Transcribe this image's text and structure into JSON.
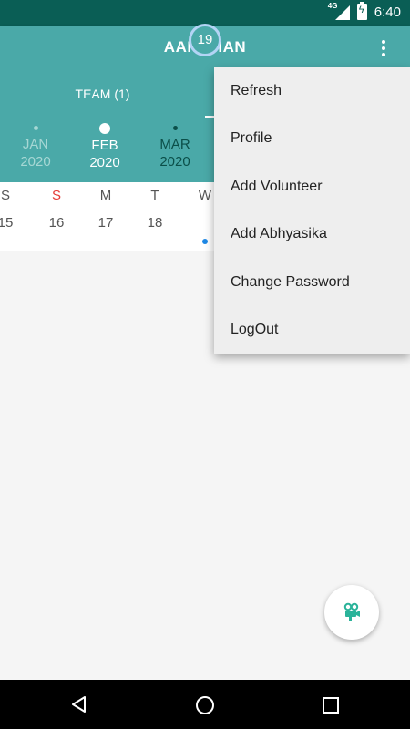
{
  "status": {
    "network": "4G",
    "time": "6:40"
  },
  "app": {
    "title": "AAROHAN"
  },
  "tabs": [
    {
      "label": "TEAM (1)"
    }
  ],
  "months": [
    {
      "name": "JAN",
      "year": "2020"
    },
    {
      "name": "FEB",
      "year": "2020"
    },
    {
      "name": "MAR",
      "year": "2020"
    }
  ],
  "week": [
    {
      "weekday": "S",
      "date": "15"
    },
    {
      "weekday": "S",
      "date": "16"
    },
    {
      "weekday": "M",
      "date": "17"
    },
    {
      "weekday": "T",
      "date": "18"
    },
    {
      "weekday": "W",
      "date": "19"
    }
  ],
  "menu": [
    {
      "label": "Refresh"
    },
    {
      "label": "Profile"
    },
    {
      "label": "Add Volunteer"
    },
    {
      "label": "Add Abhyasika"
    },
    {
      "label": "Change Password"
    },
    {
      "label": "LogOut"
    }
  ],
  "colors": {
    "primary": "#4aa9a8",
    "status_bar": "#0a5e55",
    "accent_dot": "#1e88e5",
    "sunday": "#e53935"
  },
  "icons": {
    "fab": "video-camera-icon",
    "overflow": "more-vert-icon"
  }
}
